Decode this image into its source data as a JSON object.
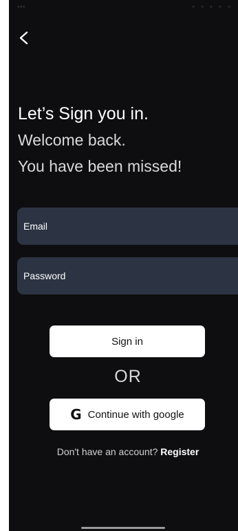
{
  "screen": {
    "back_icon": "chevron-left-icon",
    "headline": "Let’s Sign you in.",
    "welcome_line": "Welcome back.",
    "missed_line": "You have been missed!"
  },
  "form": {
    "email_placeholder": "Email",
    "password_placeholder": "Password"
  },
  "actions": {
    "signin_label": "Sign in",
    "or_label": "OR",
    "google_icon": "google-g-icon",
    "google_label": "Continue with google"
  },
  "footer": {
    "prompt": "Don't have an account?",
    "register_label": "Register"
  },
  "colors": {
    "background": "#0e0e10",
    "field": "#2c3443",
    "button": "#ffffff"
  }
}
